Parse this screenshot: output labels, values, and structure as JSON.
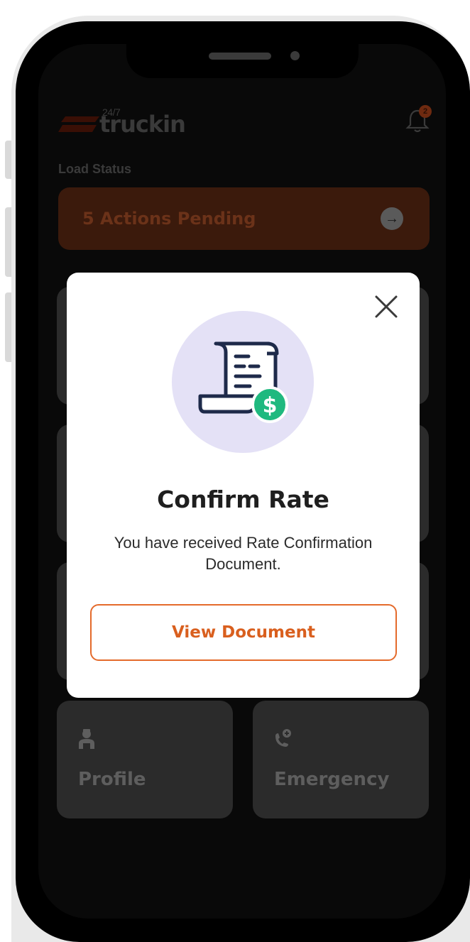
{
  "header": {
    "logo_superscript": "24/7",
    "logo_text": "truckin",
    "notification_count": "2"
  },
  "load_status": {
    "label": "Load Status",
    "pending_text": "5 Actions Pending"
  },
  "tiles": [
    {
      "label": "Profile",
      "icon": "driver-icon"
    },
    {
      "label": "Emergency",
      "icon": "phone-plus-icon"
    }
  ],
  "modal": {
    "title": "Confirm Rate",
    "message": "You have received Rate Confirmation Document.",
    "button_label": "View Document",
    "illustration_icon": "receipt-dollar-icon",
    "close_icon": "close-icon"
  },
  "colors": {
    "accent": "#e46a2b",
    "illustration_bg": "#e4e1f6",
    "dollar_green": "#1fb97f",
    "overlay_dim": "#090909"
  }
}
